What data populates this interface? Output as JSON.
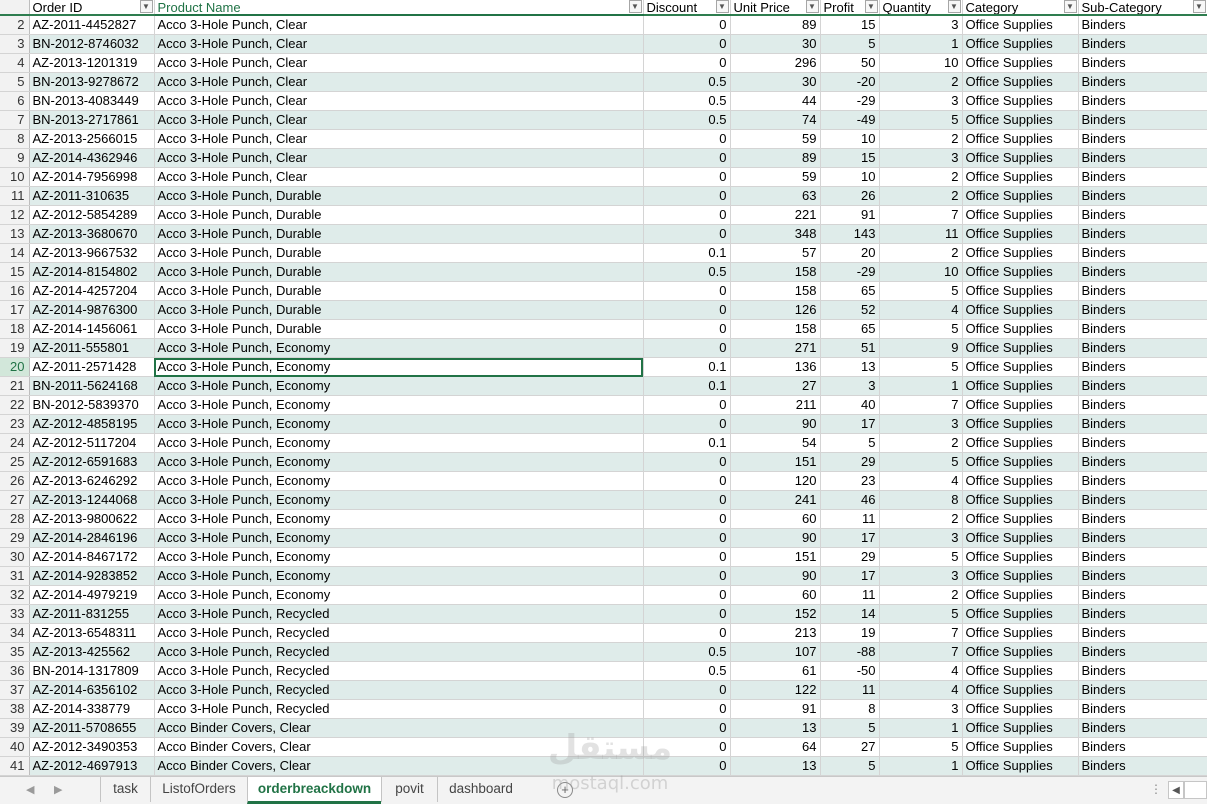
{
  "columns": [
    {
      "label": "Order ID",
      "align": "left"
    },
    {
      "label": "Product Name",
      "align": "left"
    },
    {
      "label": "Discount",
      "align": "right"
    },
    {
      "label": "Unit Price",
      "align": "right"
    },
    {
      "label": "Profit",
      "align": "right"
    },
    {
      "label": "Quantity",
      "align": "right"
    },
    {
      "label": "Category",
      "align": "left"
    },
    {
      "label": "Sub-Category",
      "align": "left"
    }
  ],
  "selected_column": 1,
  "selected_cell": {
    "row": 20,
    "col": 1
  },
  "filter_glyph": "▼",
  "rows": [
    {
      "n": 2,
      "cells": [
        "AZ-2011-4452827",
        "Acco 3-Hole Punch, Clear",
        "0",
        "89",
        "15",
        "3",
        "Office Supplies",
        "Binders"
      ]
    },
    {
      "n": 3,
      "cells": [
        "BN-2012-8746032",
        "Acco 3-Hole Punch, Clear",
        "0",
        "30",
        "5",
        "1",
        "Office Supplies",
        "Binders"
      ]
    },
    {
      "n": 4,
      "cells": [
        "AZ-2013-1201319",
        "Acco 3-Hole Punch, Clear",
        "0",
        "296",
        "50",
        "10",
        "Office Supplies",
        "Binders"
      ]
    },
    {
      "n": 5,
      "cells": [
        "BN-2013-9278672",
        "Acco 3-Hole Punch, Clear",
        "0.5",
        "30",
        "-20",
        "2",
        "Office Supplies",
        "Binders"
      ]
    },
    {
      "n": 6,
      "cells": [
        "BN-2013-4083449",
        "Acco 3-Hole Punch, Clear",
        "0.5",
        "44",
        "-29",
        "3",
        "Office Supplies",
        "Binders"
      ]
    },
    {
      "n": 7,
      "cells": [
        "BN-2013-2717861",
        "Acco 3-Hole Punch, Clear",
        "0.5",
        "74",
        "-49",
        "5",
        "Office Supplies",
        "Binders"
      ]
    },
    {
      "n": 8,
      "cells": [
        "AZ-2013-2566015",
        "Acco 3-Hole Punch, Clear",
        "0",
        "59",
        "10",
        "2",
        "Office Supplies",
        "Binders"
      ]
    },
    {
      "n": 9,
      "cells": [
        "AZ-2014-4362946",
        "Acco 3-Hole Punch, Clear",
        "0",
        "89",
        "15",
        "3",
        "Office Supplies",
        "Binders"
      ]
    },
    {
      "n": 10,
      "cells": [
        "AZ-2014-7956998",
        "Acco 3-Hole Punch, Clear",
        "0",
        "59",
        "10",
        "2",
        "Office Supplies",
        "Binders"
      ]
    },
    {
      "n": 11,
      "cells": [
        "AZ-2011-310635",
        "Acco 3-Hole Punch, Durable",
        "0",
        "63",
        "26",
        "2",
        "Office Supplies",
        "Binders"
      ]
    },
    {
      "n": 12,
      "cells": [
        "AZ-2012-5854289",
        "Acco 3-Hole Punch, Durable",
        "0",
        "221",
        "91",
        "7",
        "Office Supplies",
        "Binders"
      ]
    },
    {
      "n": 13,
      "cells": [
        "AZ-2013-3680670",
        "Acco 3-Hole Punch, Durable",
        "0",
        "348",
        "143",
        "11",
        "Office Supplies",
        "Binders"
      ]
    },
    {
      "n": 14,
      "cells": [
        "AZ-2013-9667532",
        "Acco 3-Hole Punch, Durable",
        "0.1",
        "57",
        "20",
        "2",
        "Office Supplies",
        "Binders"
      ]
    },
    {
      "n": 15,
      "cells": [
        "AZ-2014-8154802",
        "Acco 3-Hole Punch, Durable",
        "0.5",
        "158",
        "-29",
        "10",
        "Office Supplies",
        "Binders"
      ]
    },
    {
      "n": 16,
      "cells": [
        "AZ-2014-4257204",
        "Acco 3-Hole Punch, Durable",
        "0",
        "158",
        "65",
        "5",
        "Office Supplies",
        "Binders"
      ]
    },
    {
      "n": 17,
      "cells": [
        "AZ-2014-9876300",
        "Acco 3-Hole Punch, Durable",
        "0",
        "126",
        "52",
        "4",
        "Office Supplies",
        "Binders"
      ]
    },
    {
      "n": 18,
      "cells": [
        "AZ-2014-1456061",
        "Acco 3-Hole Punch, Durable",
        "0",
        "158",
        "65",
        "5",
        "Office Supplies",
        "Binders"
      ]
    },
    {
      "n": 19,
      "cells": [
        "AZ-2011-555801",
        "Acco 3-Hole Punch, Economy",
        "0",
        "271",
        "51",
        "9",
        "Office Supplies",
        "Binders"
      ]
    },
    {
      "n": 20,
      "cells": [
        "AZ-2011-2571428",
        "Acco 3-Hole Punch, Economy",
        "0.1",
        "136",
        "13",
        "5",
        "Office Supplies",
        "Binders"
      ]
    },
    {
      "n": 21,
      "cells": [
        "BN-2011-5624168",
        "Acco 3-Hole Punch, Economy",
        "0.1",
        "27",
        "3",
        "1",
        "Office Supplies",
        "Binders"
      ]
    },
    {
      "n": 22,
      "cells": [
        "BN-2012-5839370",
        "Acco 3-Hole Punch, Economy",
        "0",
        "211",
        "40",
        "7",
        "Office Supplies",
        "Binders"
      ]
    },
    {
      "n": 23,
      "cells": [
        "AZ-2012-4858195",
        "Acco 3-Hole Punch, Economy",
        "0",
        "90",
        "17",
        "3",
        "Office Supplies",
        "Binders"
      ]
    },
    {
      "n": 24,
      "cells": [
        "AZ-2012-5117204",
        "Acco 3-Hole Punch, Economy",
        "0.1",
        "54",
        "5",
        "2",
        "Office Supplies",
        "Binders"
      ]
    },
    {
      "n": 25,
      "cells": [
        "AZ-2012-6591683",
        "Acco 3-Hole Punch, Economy",
        "0",
        "151",
        "29",
        "5",
        "Office Supplies",
        "Binders"
      ]
    },
    {
      "n": 26,
      "cells": [
        "AZ-2013-6246292",
        "Acco 3-Hole Punch, Economy",
        "0",
        "120",
        "23",
        "4",
        "Office Supplies",
        "Binders"
      ]
    },
    {
      "n": 27,
      "cells": [
        "AZ-2013-1244068",
        "Acco 3-Hole Punch, Economy",
        "0",
        "241",
        "46",
        "8",
        "Office Supplies",
        "Binders"
      ]
    },
    {
      "n": 28,
      "cells": [
        "AZ-2013-9800622",
        "Acco 3-Hole Punch, Economy",
        "0",
        "60",
        "11",
        "2",
        "Office Supplies",
        "Binders"
      ]
    },
    {
      "n": 29,
      "cells": [
        "AZ-2014-2846196",
        "Acco 3-Hole Punch, Economy",
        "0",
        "90",
        "17",
        "3",
        "Office Supplies",
        "Binders"
      ]
    },
    {
      "n": 30,
      "cells": [
        "AZ-2014-8467172",
        "Acco 3-Hole Punch, Economy",
        "0",
        "151",
        "29",
        "5",
        "Office Supplies",
        "Binders"
      ]
    },
    {
      "n": 31,
      "cells": [
        "AZ-2014-9283852",
        "Acco 3-Hole Punch, Economy",
        "0",
        "90",
        "17",
        "3",
        "Office Supplies",
        "Binders"
      ]
    },
    {
      "n": 32,
      "cells": [
        "AZ-2014-4979219",
        "Acco 3-Hole Punch, Economy",
        "0",
        "60",
        "11",
        "2",
        "Office Supplies",
        "Binders"
      ]
    },
    {
      "n": 33,
      "cells": [
        "AZ-2011-831255",
        "Acco 3-Hole Punch, Recycled",
        "0",
        "152",
        "14",
        "5",
        "Office Supplies",
        "Binders"
      ]
    },
    {
      "n": 34,
      "cells": [
        "AZ-2013-6548311",
        "Acco 3-Hole Punch, Recycled",
        "0",
        "213",
        "19",
        "7",
        "Office Supplies",
        "Binders"
      ]
    },
    {
      "n": 35,
      "cells": [
        "AZ-2013-425562",
        "Acco 3-Hole Punch, Recycled",
        "0.5",
        "107",
        "-88",
        "7",
        "Office Supplies",
        "Binders"
      ]
    },
    {
      "n": 36,
      "cells": [
        "BN-2014-1317809",
        "Acco 3-Hole Punch, Recycled",
        "0.5",
        "61",
        "-50",
        "4",
        "Office Supplies",
        "Binders"
      ]
    },
    {
      "n": 37,
      "cells": [
        "AZ-2014-6356102",
        "Acco 3-Hole Punch, Recycled",
        "0",
        "122",
        "11",
        "4",
        "Office Supplies",
        "Binders"
      ]
    },
    {
      "n": 38,
      "cells": [
        "AZ-2014-338779",
        "Acco 3-Hole Punch, Recycled",
        "0",
        "91",
        "8",
        "3",
        "Office Supplies",
        "Binders"
      ]
    },
    {
      "n": 39,
      "cells": [
        "AZ-2011-5708655",
        "Acco Binder Covers, Clear",
        "0",
        "13",
        "5",
        "1",
        "Office Supplies",
        "Binders"
      ]
    },
    {
      "n": 40,
      "cells": [
        "AZ-2012-3490353",
        "Acco Binder Covers, Clear",
        "0",
        "64",
        "27",
        "5",
        "Office Supplies",
        "Binders"
      ]
    },
    {
      "n": 41,
      "cells": [
        "AZ-2012-4697913",
        "Acco Binder Covers, Clear",
        "0",
        "13",
        "5",
        "1",
        "Office Supplies",
        "Binders"
      ]
    }
  ],
  "sheet_tabs": [
    {
      "label": "task",
      "active": false
    },
    {
      "label": "ListofOrders",
      "active": false
    },
    {
      "label": "orderbreackdown",
      "active": true
    },
    {
      "label": "povit",
      "active": false
    },
    {
      "label": "dashboard",
      "active": false
    }
  ],
  "tabbar": {
    "prev_glyph": "◀",
    "next_glyph": "▶",
    "add_glyph": "+",
    "options_glyph": "⋮",
    "scroll_left_glyph": "◀"
  },
  "watermark": {
    "arabic": "مستقل",
    "latin": "mostaql.com"
  },
  "colors": {
    "accent": "#217346",
    "band": "#dfecea"
  }
}
